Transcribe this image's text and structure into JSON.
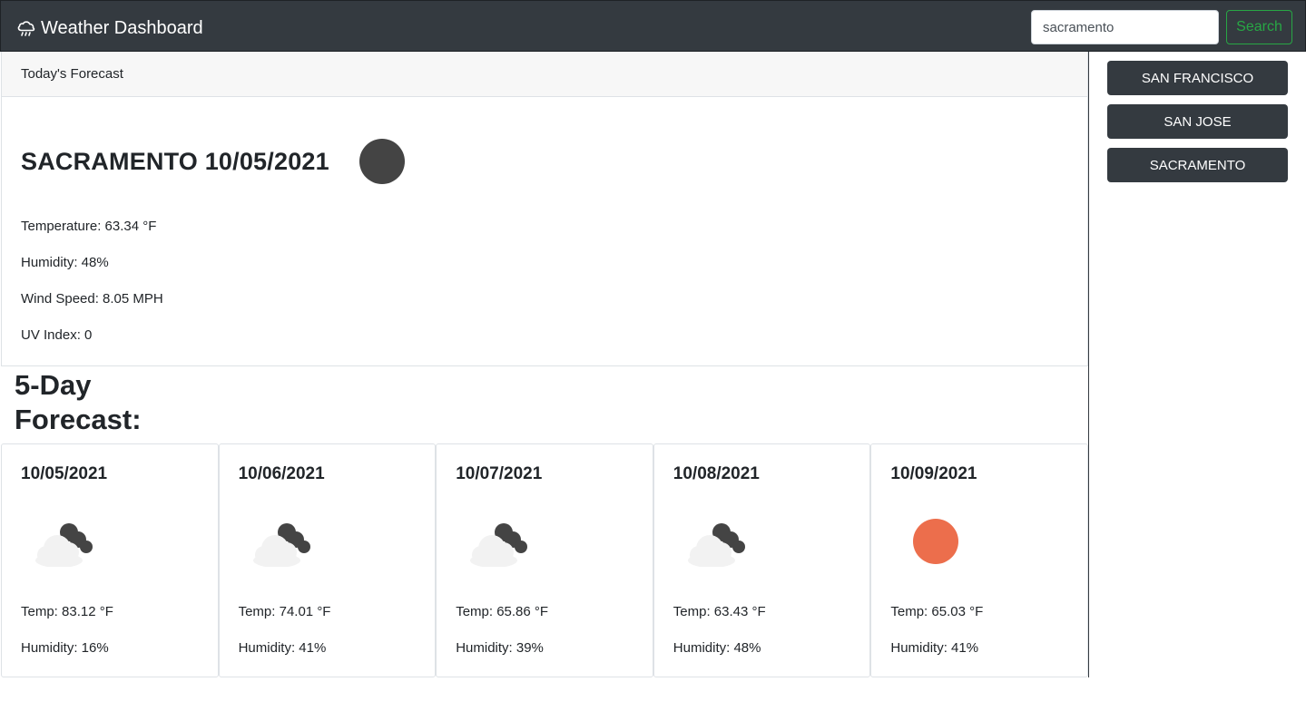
{
  "navbar": {
    "brand": "Weather Dashboard",
    "brand_icon": "cloud-rain-icon",
    "search_value": "sacramento",
    "search_button": "Search"
  },
  "history": [
    "SAN FRANCISCO",
    "SAN JOSE",
    "SACRAMENTO"
  ],
  "today": {
    "header": "Today's Forecast",
    "title": "SACRAMENTO 10/05/2021",
    "icon": "clear-night-icon",
    "temperature": "Temperature: 63.34 °F",
    "humidity": "Humidity: 48%",
    "wind": "Wind Speed: 8.05 MPH",
    "uv": "UV Index: 0"
  },
  "forecast_title": "5-Day Forecast:",
  "forecast": [
    {
      "date": "10/05/2021",
      "icon": "partly-cloudy-night-icon",
      "temp": "Temp: 83.12 °F",
      "humidity": "Humidity: 16%"
    },
    {
      "date": "10/06/2021",
      "icon": "partly-cloudy-night-icon",
      "temp": "Temp: 74.01 °F",
      "humidity": "Humidity: 41%"
    },
    {
      "date": "10/07/2021",
      "icon": "partly-cloudy-night-icon",
      "temp": "Temp: 65.86 °F",
      "humidity": "Humidity: 39%"
    },
    {
      "date": "10/08/2021",
      "icon": "partly-cloudy-night-icon",
      "temp": "Temp: 63.43 °F",
      "humidity": "Humidity: 48%"
    },
    {
      "date": "10/09/2021",
      "icon": "sun-icon",
      "temp": "Temp: 65.03 °F",
      "humidity": "Humidity: 41%"
    }
  ],
  "colors": {
    "navbar": "#343a40",
    "search_accent": "#28a745",
    "sun": "#ec6e4c",
    "moon": "#444444"
  }
}
